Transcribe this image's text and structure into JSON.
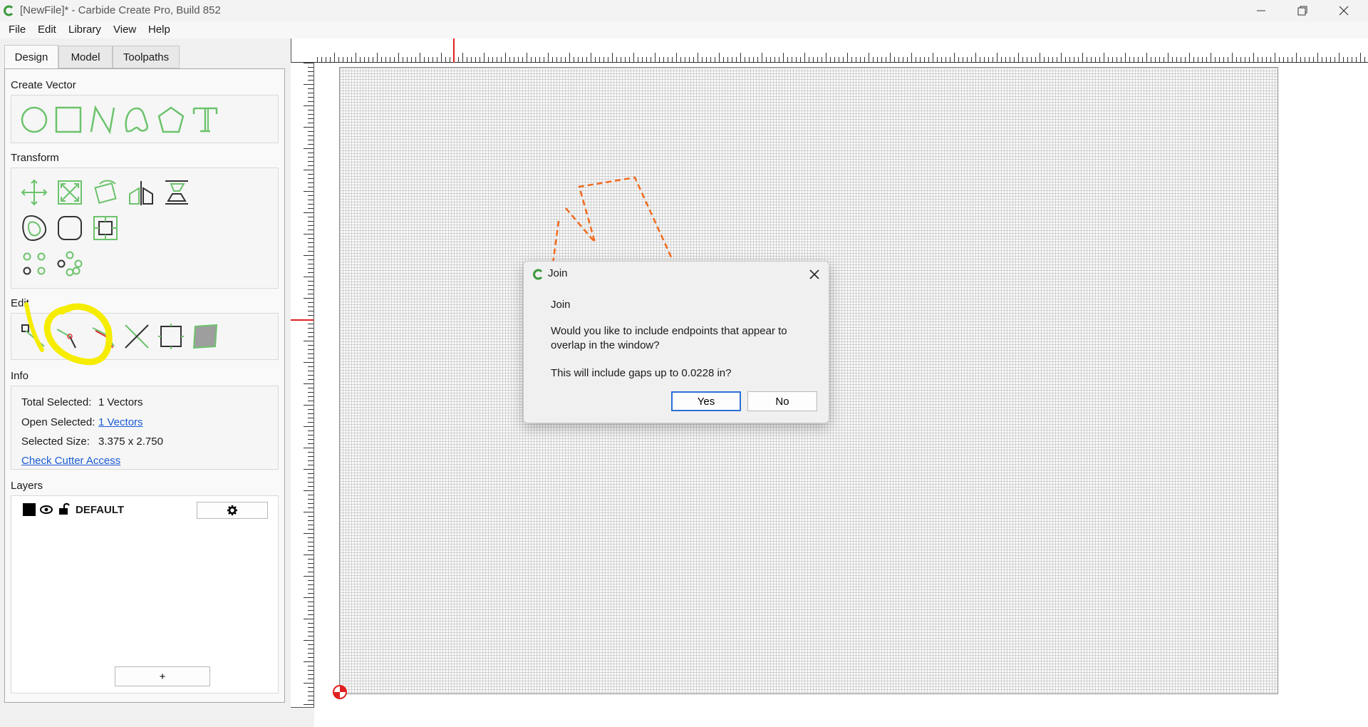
{
  "window": {
    "title": "[NewFile]* - Carbide Create Pro, Build 852"
  },
  "menu": {
    "file": "File",
    "edit": "Edit",
    "library": "Library",
    "view": "View",
    "help": "Help"
  },
  "tabs": {
    "design": "Design",
    "model": "Model",
    "toolpaths": "Toolpaths"
  },
  "sections": {
    "create_vector": "Create Vector",
    "transform": "Transform",
    "edit": "Edit",
    "info": "Info",
    "layers": "Layers"
  },
  "info": {
    "total_selected_label": "Total Selected:",
    "total_selected_value": "1 Vectors",
    "open_selected_label": "Open Selected:",
    "open_selected_value": "1 Vectors",
    "selected_size_label": "Selected Size:",
    "selected_size_value": "3.375 x 2.750",
    "check_cutter_access": "Check Cutter Access"
  },
  "layers": {
    "default_name": "DEFAULT",
    "add_label": "+"
  },
  "dialog": {
    "title": "Join",
    "header": "Join",
    "message": "Would you like to include endpoints that appear to overlap in the window?",
    "gap_text": "This will include gaps up to 0.0228 in?",
    "yes": "Yes",
    "no": "No"
  },
  "colors": {
    "accent_green": "#6cc36c",
    "vector_orange": "#f26a1b",
    "annotation_yellow": "#f5ec00",
    "ruler_marker": "#e02020"
  }
}
